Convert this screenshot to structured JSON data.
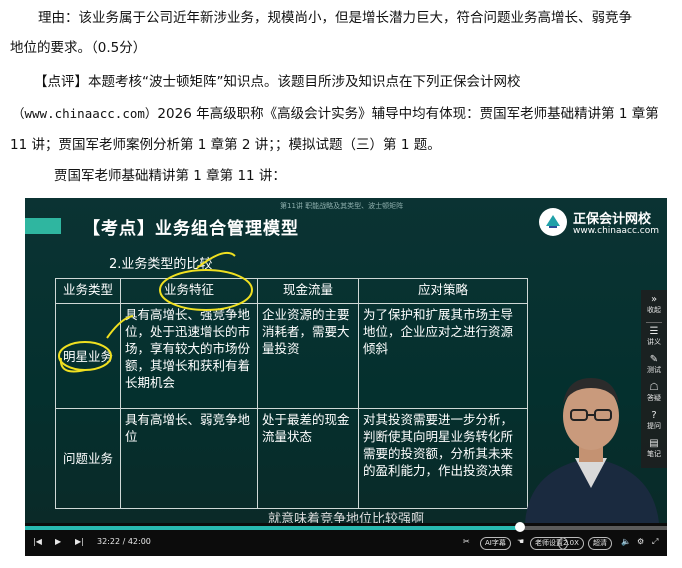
{
  "document": {
    "reason_line": "理由：该业务属于公司近年新涉业务，规模尚小，但是增长潜力巨大，符合问题业务高增长、弱竞争",
    "reason_cont": "地位的要求。（0.5分）",
    "comment_line": "【点评】本题考核“波士顿矩阵”知识点。该题目所涉及知识点在下列正保会计网校",
    "source_url": "（www.chinaacc.com）",
    "source_rest": "2026 年高级职称《高级会计实务》辅导中均有体现：贾国军老师基础精讲第 1 章第",
    "source_cont": "11 讲；贾国军老师案例分析第 1 章第 2 讲；；模拟试题（三）第 1 题。",
    "lecture_ref": "贾国军老师基础精讲第 1 章第 11 讲："
  },
  "video": {
    "lecture_caption": "第11讲  职能战略及其类型、波士顿矩阵",
    "title": "【考点】业务组合管理模型",
    "subtitle": "2.业务类型的比较",
    "logo_name": "正保会计网校",
    "logo_url": "www.chinaacc.com",
    "table": {
      "headers": [
        "业务类型",
        "业务特征",
        "现金流量",
        "应对策略"
      ],
      "rows": [
        [
          "明星业务",
          "具有高增长、强竞争地位，处于迅速增长的市场，享有较大的市场份额，其增长和获利有着长期机会",
          "企业资源的主要消耗者，需要大量投资",
          "为了保护和扩展其市场主导地位，企业应对之进行资源倾斜"
        ],
        [
          "问题业务",
          "具有高增长、弱竞争地位",
          "处于最差的现金流量状态",
          "对其投资需要进一步分析，判断使其向明星业务转化所需要的投资额，分析其未来的盈利能力，作出投资决策"
        ]
      ]
    },
    "caption": "就意味着竞争地位比较强啊"
  },
  "rail": [
    "收起",
    "讲义",
    "测试",
    "答疑",
    "提问",
    "笔记"
  ],
  "controls": {
    "time": "32:22 / 42:00",
    "progress": 0.771,
    "ai_subtitle": "AI字幕",
    "teacher_setting": "老师设置",
    "speed": "2.0X",
    "quality": "超清"
  }
}
